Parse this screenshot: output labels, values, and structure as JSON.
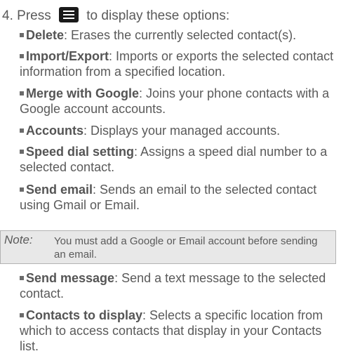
{
  "step": {
    "number": "4.",
    "text_before": "Press",
    "icon": "menu-key-icon",
    "text_after": "to display these options:"
  },
  "options": [
    {
      "term": "Delete",
      "desc": ": Erases the currently selected contact(s)."
    },
    {
      "term": "Import/Export",
      "desc": ": Imports or exports the selected contact information from a specified location."
    },
    {
      "term": "Merge with Google",
      "desc": ": Joins your phone contacts with a Google account accounts."
    },
    {
      "term": "Accounts",
      "desc": ": Displays your managed accounts."
    },
    {
      "term": "Speed dial setting",
      "desc": ": Assigns a speed dial number to a selected contact."
    },
    {
      "term": "Send email",
      "desc": ": Sends an email to the selected contact using Gmail or Email."
    },
    {
      "term": "Send message",
      "desc": ": Send a text message to the selected contact."
    },
    {
      "term": "Contacts to display",
      "desc": ": Selects a specific location from which to access contacts that display in your Contacts list."
    }
  ],
  "note": {
    "label": "Note:",
    "text": "You must add a Google or Email account before sending an email."
  },
  "colors": {
    "text": "#5a5a5a",
    "note_background": "#e8e8e8",
    "note_border": "#b3b3b3",
    "icon_background": "#1a1a1a"
  }
}
